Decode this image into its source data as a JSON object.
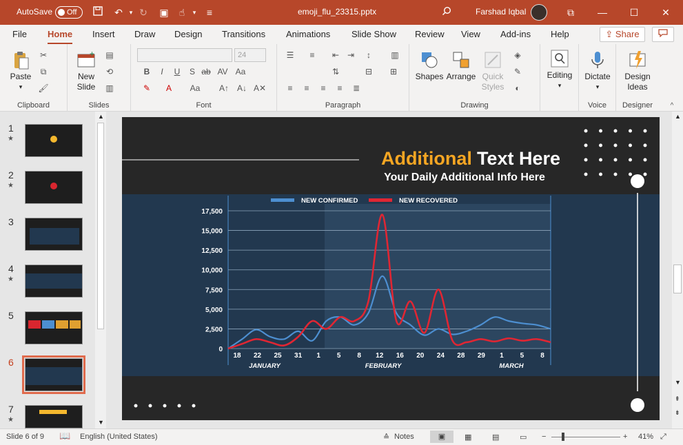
{
  "titlebar": {
    "autosave_label": "AutoSave",
    "autosave_state": "Off",
    "filename": "emoji_flu_23315.pptx",
    "user": "Farshad Iqbal"
  },
  "tabs": [
    "File",
    "Home",
    "Insert",
    "Draw",
    "Design",
    "Transitions",
    "Animations",
    "Slide Show",
    "Review",
    "View",
    "Add-ins",
    "Help"
  ],
  "active_tab": "Home",
  "share_label": "Share",
  "ribbon": {
    "clipboard": {
      "paste": "Paste",
      "label": "Clipboard"
    },
    "slides": {
      "new_slide_1": "New",
      "new_slide_2": "Slide",
      "label": "Slides"
    },
    "font": {
      "size": "24",
      "label": "Font"
    },
    "paragraph": {
      "label": "Paragraph"
    },
    "drawing": {
      "shapes": "Shapes",
      "arrange": "Arrange",
      "quick_1": "Quick",
      "quick_2": "Styles",
      "label": "Drawing"
    },
    "editing": {
      "label": "Editing"
    },
    "voice": {
      "dictate": "Dictate",
      "label": "Voice"
    },
    "designer": {
      "ideas_1": "Design",
      "ideas_2": "Ideas",
      "label": "Designer"
    }
  },
  "thumbnails": [
    {
      "num": "1",
      "star": true
    },
    {
      "num": "2",
      "star": true
    },
    {
      "num": "3",
      "star": false
    },
    {
      "num": "4",
      "star": true
    },
    {
      "num": "5",
      "star": false
    },
    {
      "num": "6",
      "star": false,
      "selected": true
    },
    {
      "num": "7",
      "star": true
    }
  ],
  "slide": {
    "title_accent": "Additional",
    "title_rest": "Text Here",
    "subtitle": "Your Daily Additional Info Here"
  },
  "chart_data": {
    "type": "line",
    "series": [
      {
        "name": "NEW CONFIRMED",
        "color": "#4d8fd1",
        "values": [
          0,
          1200,
          2400,
          1500,
          1200,
          2200,
          1000,
          3500,
          4000,
          3000,
          4500,
          9200,
          4500,
          3000,
          1700,
          2500,
          1800,
          2200,
          3000,
          4000,
          3500,
          3200,
          3000,
          2500
        ]
      },
      {
        "name": "NEW RECOVERED",
        "color": "#e02633",
        "values": [
          0,
          600,
          1200,
          800,
          400,
          1500,
          3500,
          2500,
          4000,
          3500,
          6000,
          17000,
          3500,
          6000,
          2000,
          7500,
          1000,
          800,
          1200,
          900,
          1300,
          1000,
          1200,
          800
        ]
      }
    ],
    "x_labels": [
      "18",
      "22",
      "25",
      "31",
      "1",
      "5",
      "8",
      "12",
      "16",
      "20",
      "24",
      "28",
      "29",
      "1",
      "5",
      "8"
    ],
    "month_labels": [
      "JANUARY",
      "FEBRUARY",
      "MARCH"
    ],
    "y_ticks": [
      "17,500",
      "15,000",
      "12,500",
      "10,000",
      "7,500",
      "5,000",
      "2,500",
      "0"
    ],
    "ylim": [
      0,
      17500
    ]
  },
  "status": {
    "slide_info": "Slide 6 of 9",
    "language": "English (United States)",
    "notes": "Notes",
    "zoom": "41%"
  }
}
